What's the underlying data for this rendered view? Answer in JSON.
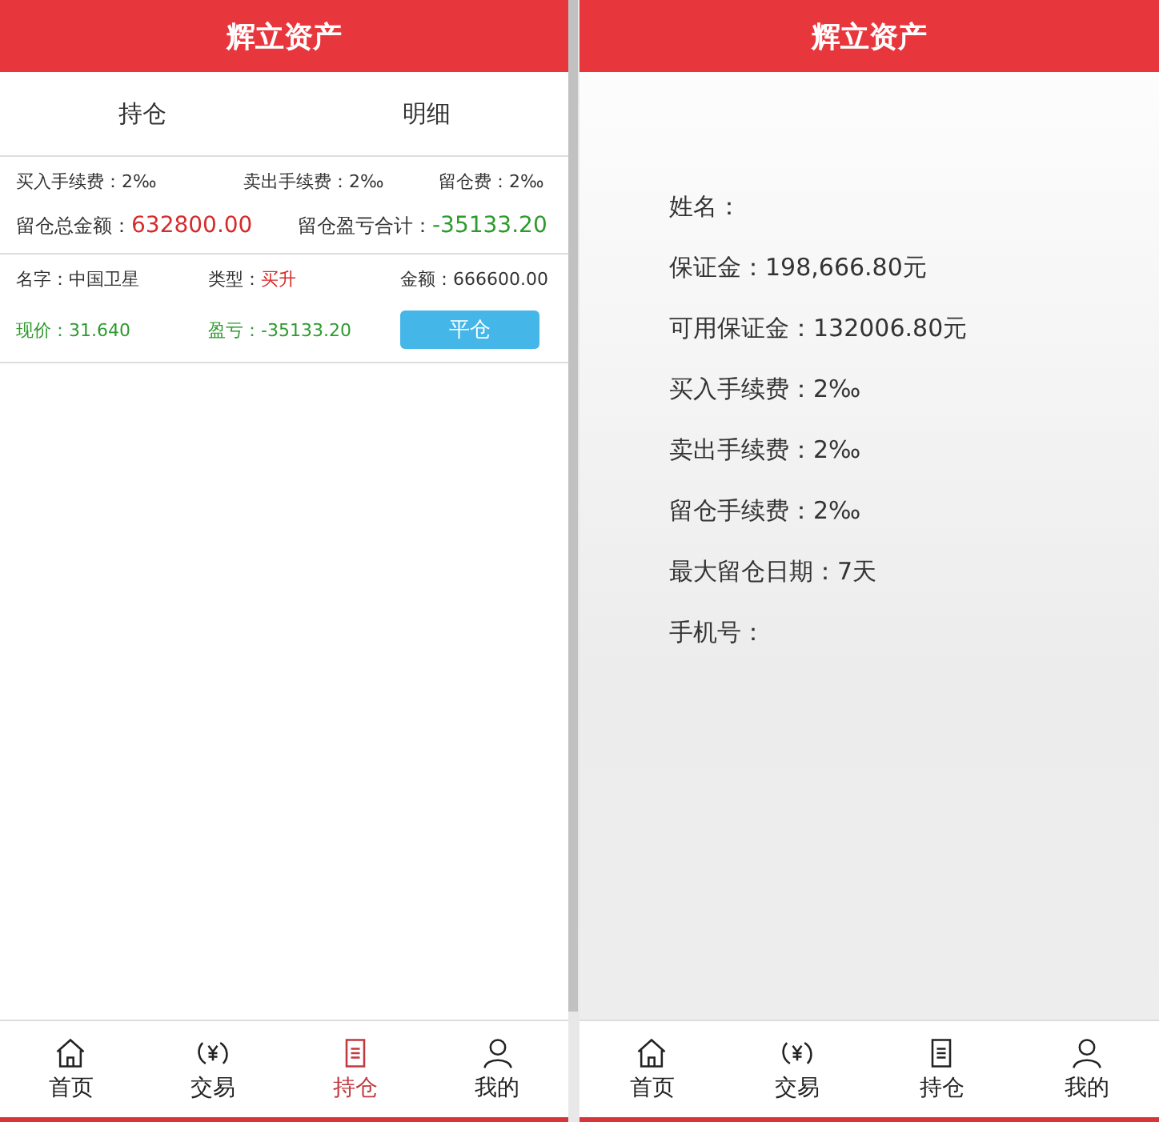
{
  "left_screen": {
    "title": "辉立资产",
    "tabs": [
      {
        "label": "持仓"
      },
      {
        "label": "明细"
      }
    ],
    "fees": [
      {
        "label": "买入手续费：",
        "value": "2‰"
      },
      {
        "label": "卖出手续费：",
        "value": "2‰"
      },
      {
        "label": "留仓费：",
        "value": "2‰"
      }
    ],
    "totals": [
      {
        "label": "留仓总金额：",
        "value": "632800.00",
        "kind": "loss"
      },
      {
        "label": "留仓盈亏合计：",
        "value": "-35133.20",
        "kind": "gain"
      }
    ],
    "position": {
      "fields": [
        {
          "label": "名字：",
          "value": "中国卫星",
          "kind": "plain"
        },
        {
          "label": "类型：",
          "value": "买升",
          "kind": "loss"
        },
        {
          "label": "金额：",
          "value": "666600.00",
          "kind": "plain"
        },
        {
          "label": "现价：",
          "value": "31.640",
          "kind": "all-green"
        },
        {
          "label": "盈亏：",
          "value": "-35133.20",
          "kind": "all-green"
        }
      ],
      "close_button": "平仓"
    },
    "tab_bar": [
      {
        "label": "首页",
        "kind": "home",
        "selected": false
      },
      {
        "label": "交易",
        "kind": "trade",
        "selected": false
      },
      {
        "label": "持仓",
        "kind": "doc",
        "selected": true
      },
      {
        "label": "我的",
        "kind": "user",
        "selected": false
      }
    ]
  },
  "right_screen": {
    "title": "辉立资产",
    "info": [
      "姓名：",
      "保证金：198,666.80元",
      "可用保证金：132006.80元",
      "买入手续费：2‰",
      "卖出手续费：2‰",
      "留仓手续费：2‰",
      "最大留仓日期：7天",
      "手机号："
    ],
    "tab_bar": [
      {
        "label": "首页",
        "kind": "home",
        "selected": false
      },
      {
        "label": "交易",
        "kind": "trade",
        "selected": false
      },
      {
        "label": "持仓",
        "kind": "doc",
        "selected": false
      },
      {
        "label": "我的",
        "kind": "user",
        "selected": false
      }
    ]
  }
}
